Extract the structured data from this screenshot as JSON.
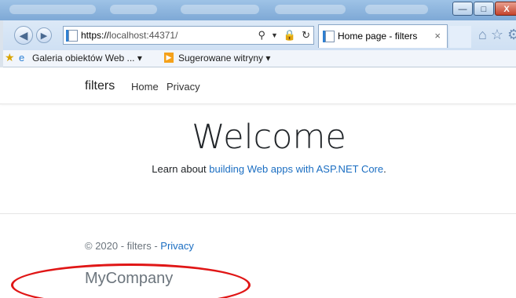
{
  "browser": {
    "url_prefix": "https://",
    "url_host": "localhost:",
    "url_port": "44371/",
    "tab_title": "Home page - filters",
    "tab_close": "×",
    "favorites": [
      {
        "label": "Galeria obiektów Web ... ▾"
      },
      {
        "label": "Sugerowane witryny ▾"
      }
    ],
    "caption_min": "—",
    "caption_max": "□",
    "caption_close": "X"
  },
  "site": {
    "brand": "filters",
    "nav": [
      {
        "label": "Home"
      },
      {
        "label": "Privacy"
      }
    ],
    "heading": "Welcome",
    "learn_prefix": "Learn about ",
    "learn_link": "building Web apps with ASP.NET Core",
    "learn_suffix": ".",
    "footer_copy": "© 2020 - filters - ",
    "footer_link": "Privacy",
    "company": "MyCompany"
  },
  "colors": {
    "link": "#1b6ec2",
    "annotation": "#e01616"
  }
}
